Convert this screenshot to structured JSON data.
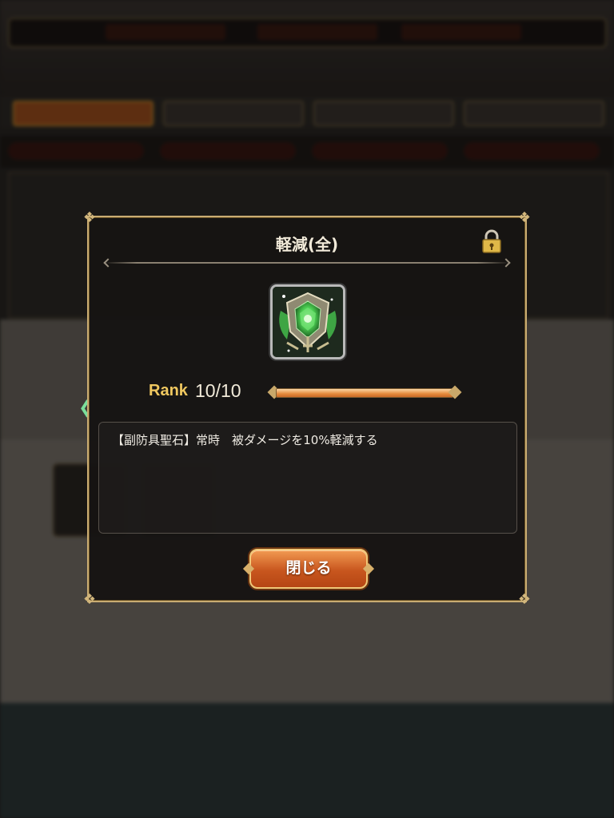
{
  "dialog": {
    "title": "軽減(全)",
    "rank_label": "Rank",
    "rank_value": "10/10",
    "rank_progress": 1.0,
    "description": "【副防具聖石】常時　被ダメージを10%軽減する",
    "close_label": "閉じる"
  },
  "icons": {
    "lock": "padlock-icon",
    "gem": "green-shield-gem-icon",
    "side_arrow": "chevron-left-icon"
  },
  "colors": {
    "dialog_border": "#c9ac72",
    "rank_label": "#f0c860",
    "button": "#c8561e",
    "gem": "#3fbf4a"
  }
}
